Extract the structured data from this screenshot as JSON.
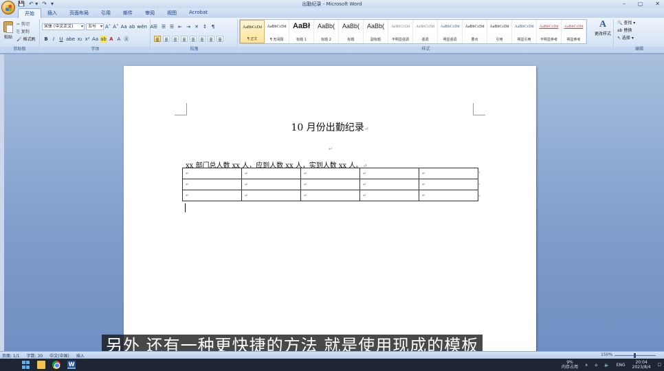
{
  "window": {
    "title": "出勤纪录 - Microsoft Word",
    "qat": [
      "💾",
      "↶ ▾",
      "↷",
      "▾"
    ],
    "controls": [
      "–",
      "▢",
      "✕"
    ]
  },
  "tabs": [
    "开始",
    "插入",
    "页面布局",
    "引用",
    "邮件",
    "审阅",
    "视图",
    "Acrobat"
  ],
  "ribbon": {
    "clipboard": {
      "paste": "粘贴",
      "cut": "✂ 剪切",
      "copy": "⎘ 复制",
      "format_painter": "🖌 格式刷",
      "label": "剪贴板"
    },
    "font": {
      "font_name": "宋体 (中文正文)",
      "font_size": "五号",
      "row1": [
        "A˄",
        "A˅",
        "Aa",
        "ab",
        "wén",
        "A"
      ],
      "row2": [
        "B",
        "I",
        "U",
        "abe",
        "x₂",
        "x²",
        "Aa",
        "ab",
        "A",
        "A",
        "Ⓐ"
      ],
      "label": "字体"
    },
    "paragraph": {
      "row1": [
        "☰",
        "☰",
        "☰",
        "⇤",
        "⇥",
        "✕",
        "↕",
        "¶"
      ],
      "label": "段落"
    },
    "styles": {
      "tiles": [
        {
          "sample": "AaBbCcDd",
          "name": "¶ 正文",
          "kind": "",
          "selected": true
        },
        {
          "sample": "AaBbCcDd",
          "name": "¶ 无间隔",
          "kind": "",
          "selected": false
        },
        {
          "sample": "AaBł",
          "name": "标题 1",
          "kind": "big",
          "selected": false
        },
        {
          "sample": "AaBb(",
          "name": "标题 2",
          "kind": "mid",
          "selected": false
        },
        {
          "sample": "AaBb(",
          "name": "标题",
          "kind": "mid",
          "selected": false
        },
        {
          "sample": "AaBb(",
          "name": "副标题",
          "kind": "mid",
          "selected": false
        },
        {
          "sample": "AaBbCcDd",
          "name": "不明显强调",
          "kind": "gray",
          "selected": false
        },
        {
          "sample": "AaBbCcDd",
          "name": "强调",
          "kind": "gray",
          "selected": false
        },
        {
          "sample": "AaBbCcDd",
          "name": "明显强调",
          "kind": "blue",
          "selected": false
        },
        {
          "sample": "AaBbCcDd",
          "name": "要点",
          "kind": "",
          "selected": false
        },
        {
          "sample": "AaBbCcDd",
          "name": "引用",
          "kind": "",
          "selected": false
        },
        {
          "sample": "AaBbCcDd",
          "name": "明显引用",
          "kind": "blue",
          "selected": false
        },
        {
          "sample": "AaBbCcDd",
          "name": "不明显参考",
          "kind": "under",
          "selected": false
        },
        {
          "sample": "AaBbCcDd",
          "name": "明显参考",
          "kind": "under",
          "selected": false
        }
      ],
      "change_styles": "更改样式",
      "label": "样式"
    },
    "editing": {
      "find": "🔍 查找 ▾",
      "replace": "ab 替换",
      "select": "↖ 选择 ▾",
      "label": "编辑"
    }
  },
  "document": {
    "title": "10 月份出勤纪录",
    "para_mark": "↵",
    "empty_mark": "↵",
    "line": "xx 部门总人数 xx 人，应到人数 xx 人，实到人数 xx 人。",
    "table_rows": [
      [
        "↵",
        "↵",
        "↵",
        "↵",
        "↵"
      ],
      [
        "↵",
        "↵",
        "↵",
        "↵",
        "↵"
      ],
      [
        "↵",
        "↵",
        "↵",
        "↵",
        "↵"
      ]
    ]
  },
  "subtitle": "另外  还有一种更快捷的方法  就是使用现成的模板",
  "statusbar": {
    "page": "页面: 1/1",
    "words": "字数: 30",
    "lang": "中文(中国)",
    "mode": "插入",
    "zoom": "150%"
  },
  "taskbar": {
    "word_icon_letter": "W",
    "cpu": "9%",
    "cpu_label": "内存占用",
    "tray_up": "∧",
    "network": "⌂",
    "sound": "🔈",
    "ime": "ENG",
    "time": "20:04",
    "date": "2023/8/4",
    "notify": "☐"
  }
}
